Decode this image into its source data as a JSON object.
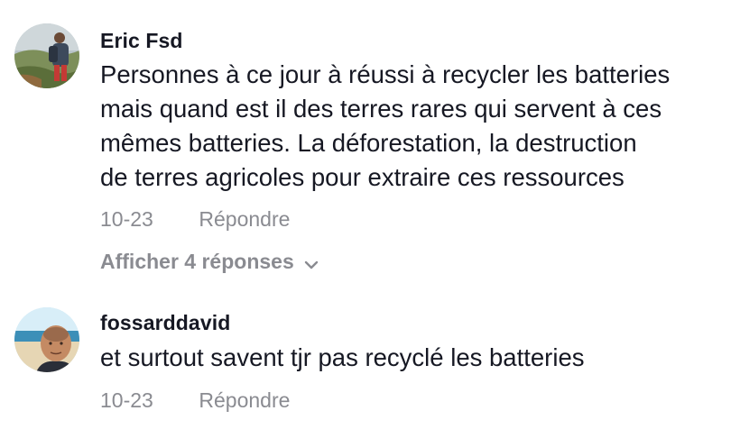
{
  "comments": [
    {
      "username": "Eric Fsd",
      "text_lines": [
        "Personnes à ce jour à réussi à recycler les batteries",
        "mais quand est il des terres rares qui servent à ces",
        "mêmes batteries. La déforestation, la destruction",
        "de terres agricoles pour extraire ces ressources"
      ],
      "date": "10-23",
      "reply_label": "Répondre",
      "view_replies_label": "Afficher 4 réponses"
    },
    {
      "username": "fossarddavid",
      "text_lines": [
        "et surtout savent tjr pas recyclé les batteries"
      ],
      "date": "10-23",
      "reply_label": "Répondre"
    }
  ],
  "icons": {
    "view_replies": "chevron-down-icon"
  },
  "colors": {
    "primary_text": "#161823",
    "secondary_text": "#8a8b91",
    "background": "#ffffff"
  }
}
